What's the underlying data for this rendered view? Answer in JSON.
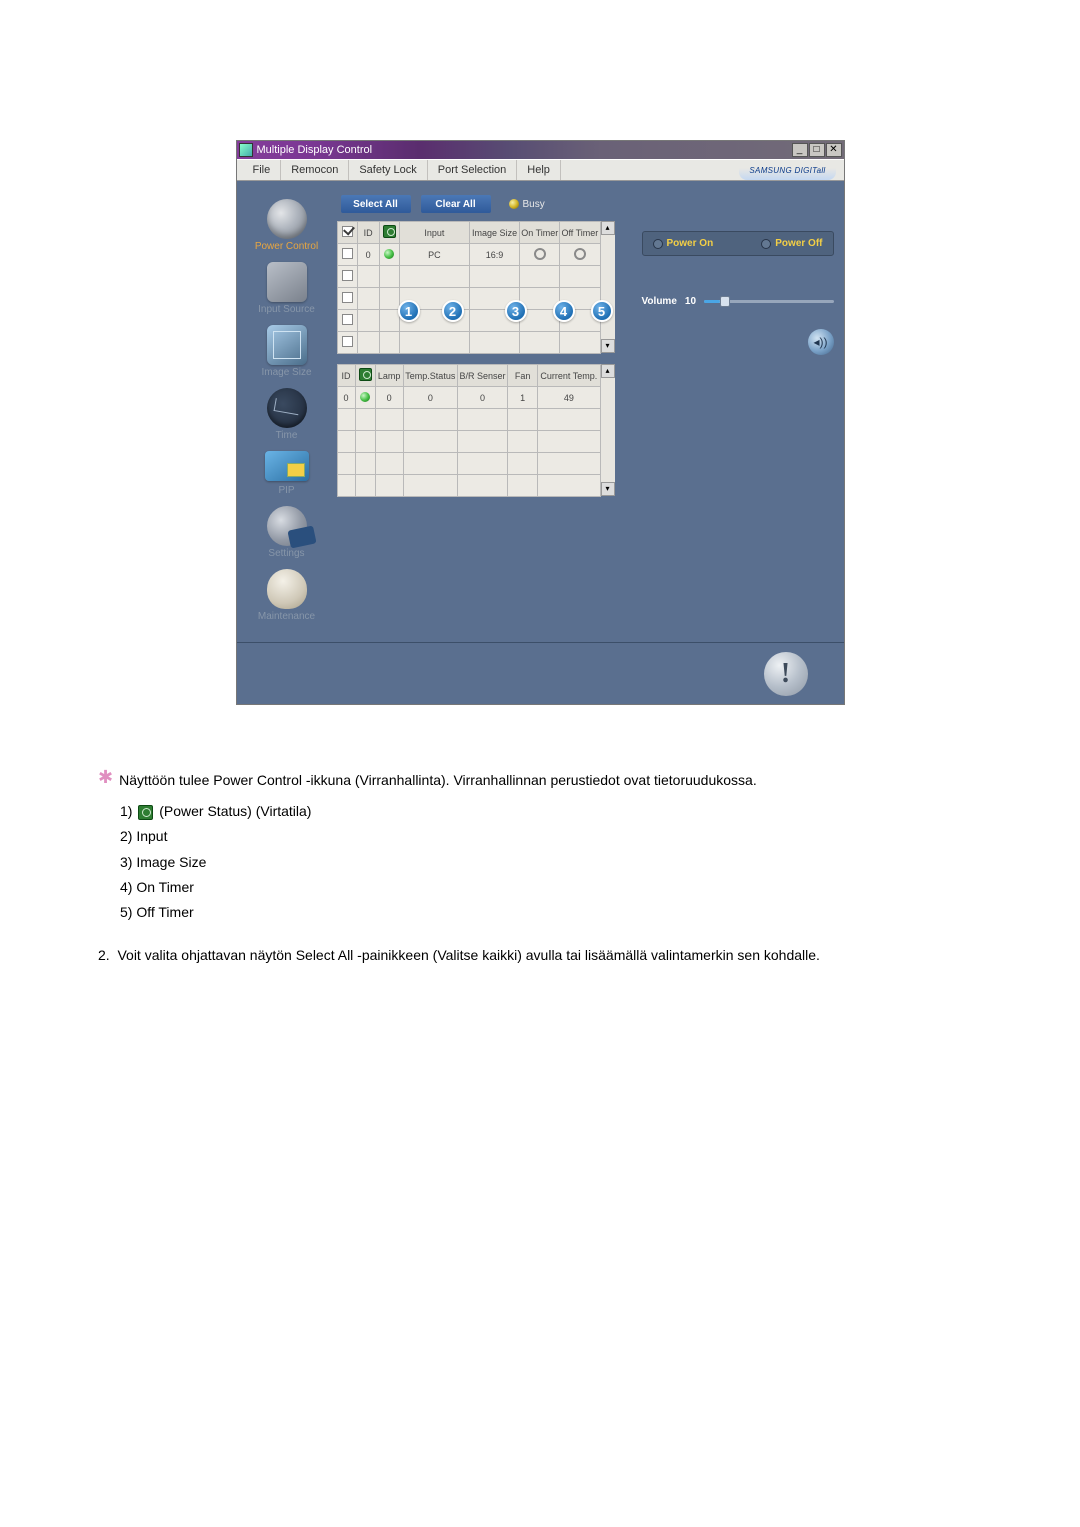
{
  "window": {
    "title": "Multiple Display Control",
    "brand": "SAMSUNG DIGITall"
  },
  "menu": [
    "File",
    "Remocon",
    "Safety Lock",
    "Port Selection",
    "Help"
  ],
  "sidebar": [
    {
      "label": "Power Control",
      "active": true,
      "icon": "pc"
    },
    {
      "label": "Input Source",
      "active": false,
      "icon": "is"
    },
    {
      "label": "Image Size",
      "active": false,
      "icon": "sz"
    },
    {
      "label": "Time",
      "active": false,
      "icon": "tm"
    },
    {
      "label": "PIP",
      "active": false,
      "icon": "pp"
    },
    {
      "label": "Settings",
      "active": false,
      "icon": "st"
    },
    {
      "label": "Maintenance",
      "active": false,
      "icon": "mt"
    }
  ],
  "toolbar": {
    "select": "Select All",
    "clear": "Clear All",
    "busy": "Busy"
  },
  "grid1": {
    "headers": [
      "",
      "ID",
      "",
      "Input",
      "Image Size",
      "On Timer",
      "Off Timer"
    ],
    "row": {
      "id": "0",
      "input": "PC",
      "size": "16:9"
    }
  },
  "grid2": {
    "headers": [
      "ID",
      "",
      "Lamp",
      "Temp.Status",
      "B/R Senser",
      "Fan",
      "Current Temp."
    ],
    "row": {
      "id": "0",
      "lamp": "0",
      "temp": "0",
      "br": "0",
      "fan": "1",
      "ct": "49"
    }
  },
  "power": {
    "on": "Power On",
    "off": "Power Off"
  },
  "volume": {
    "label": "Volume",
    "value": "10"
  },
  "callouts": [
    "1",
    "2",
    "3",
    "4",
    "5"
  ],
  "doc": {
    "intro": "Näyttöön tulee Power Control -ikkuna (Virranhallinta). Virranhallinnan perustiedot ovat tietoruudukossa.",
    "items": [
      " (Power Status) (Virtatila)",
      "Input",
      "Image Size",
      "On Timer",
      "Off Timer"
    ],
    "note_num": "2.",
    "note": "Voit valita ohjattavan näytön Select All -painikkeen (Valitse kaikki) avulla tai lisäämällä valintamerkin sen kohdalle."
  }
}
